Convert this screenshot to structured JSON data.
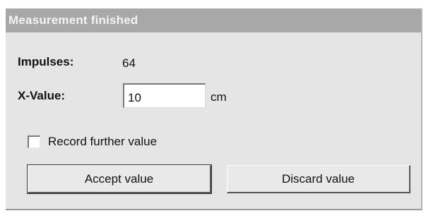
{
  "dialog": {
    "title": "Measurement finished",
    "impulses_label": "Impulses:",
    "impulses_value": "64",
    "xvalue_label": "X-Value:",
    "xvalue_input": "10",
    "xvalue_unit": "cm",
    "record_further_label": "Record further value",
    "record_further_checked": false,
    "accept_label": "Accept value",
    "discard_label": "Discard value"
  }
}
